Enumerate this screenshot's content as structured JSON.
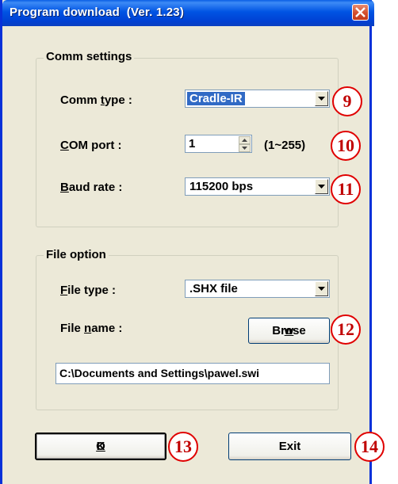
{
  "window": {
    "title": "Program download  (Ver. 1.23)"
  },
  "comm_settings": {
    "group_title": "Comm settings",
    "comm_type": {
      "label": "Comm type :",
      "value": "Cradle-IR"
    },
    "com_port": {
      "label": "COM port :",
      "value": "1",
      "range": "(1~255)"
    },
    "baud_rate": {
      "label": "Baud rate :",
      "value": "115200 bps"
    }
  },
  "file_option": {
    "group_title": "File option",
    "file_type": {
      "label": "File type :",
      "value": ".SHX file"
    },
    "file_name": {
      "label": "File name :",
      "value": "C:\\Documents and Settings\\pawel.swi"
    },
    "browse_label": "Browse"
  },
  "buttons": {
    "ok_label": "OK",
    "exit_label": "Exit"
  },
  "callouts": [
    "9",
    "10",
    "11",
    "12",
    "13",
    "14"
  ],
  "colors": {
    "title_bar": "#0054e3",
    "dialog_bg": "#ece9d8",
    "selection": "#316ac5",
    "callout": "#e00000"
  }
}
